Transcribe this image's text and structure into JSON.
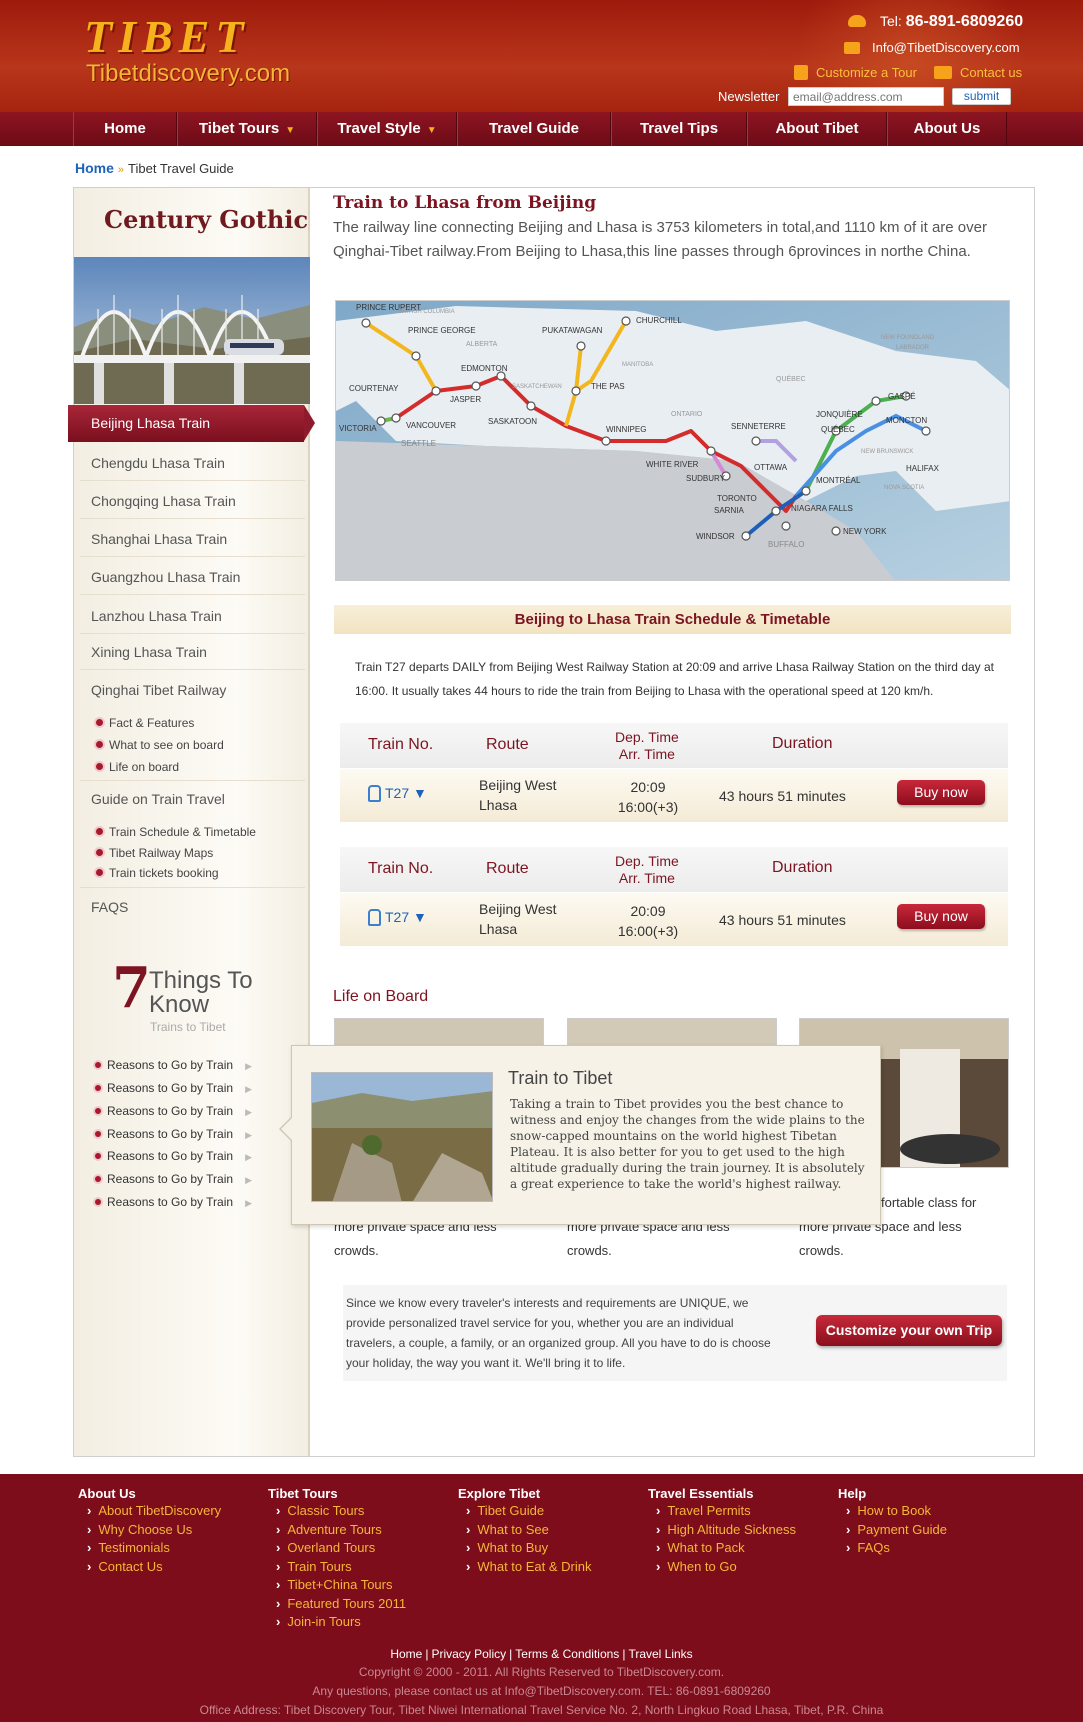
{
  "header": {
    "logo_text": "TIBET",
    "logo_sub": "Tibetdiscovery.com",
    "tel_label": "Tel:",
    "tel_number": "86-891-6809260",
    "email": "Info@TibetDiscovery.com",
    "customize_label": "Customize a Tour",
    "contact_label": "Contact us",
    "newsletter_label": "Newsletter",
    "newsletter_placeholder": "email@address.com",
    "submit_label": "submit"
  },
  "nav": {
    "items": [
      {
        "label": "Home",
        "dropdown": false
      },
      {
        "label": "Tibet Tours",
        "dropdown": true
      },
      {
        "label": "Travel Style",
        "dropdown": true
      },
      {
        "label": "Travel Guide",
        "dropdown": false
      },
      {
        "label": "Travel Tips",
        "dropdown": false
      },
      {
        "label": "About Tibet",
        "dropdown": false
      },
      {
        "label": "About Us",
        "dropdown": false
      }
    ]
  },
  "breadcrumb": {
    "home": "Home",
    "separator": "»",
    "current": "Tibet Travel Guide"
  },
  "sidebar": {
    "title": "Century Gothic",
    "active_item": "Beijing Lhasa Train",
    "items": [
      "Chengdu Lhasa Train",
      "Chongqing Lhasa Train",
      "Shanghai Lhasa Train",
      "Guangzhou Lhasa Train",
      "Lanzhou Lhasa Train",
      "Xining Lhasa Train",
      "Qinghai Tibet Railway"
    ],
    "railway_sub": [
      "Fact & Features",
      "What to see on board",
      "Life on board"
    ],
    "guide_label": "Guide on Train Travel",
    "guide_sub": [
      "Train Schedule & Timetable",
      "Tibet Railway Maps",
      "Train tickets booking"
    ],
    "faqs_label": "FAQS",
    "things": {
      "number": "7",
      "line1": "Things To",
      "line2": "Know",
      "sub": "Trains to Tibet"
    },
    "reasons": [
      "Reasons to Go by Train",
      "Reasons to Go by Train",
      "Reasons to Go by Train",
      "Reasons to Go by Train",
      "Reasons to Go by Train",
      "Reasons to Go by Train",
      "Reasons to Go by Train"
    ]
  },
  "content": {
    "title": "Train to Lhasa from Beijing",
    "intro": "The railway line connecting Beijing and Lhasa is 3753 kilometers in total,and 1110 km of it are over Qinghai-Tibet railway.From Beijing to Lhasa,this line passes through 6provinces in northe China.",
    "map_labels": {
      "prince_rupert": "PRINCE RUPERT",
      "british_columbia": "BRITISH COLUMBIA",
      "prince_george": "PRINCE GEORGE",
      "alberta": "ALBERTA",
      "pukatawagan": "PUKATAWAGAN",
      "churchill": "CHURCHILL",
      "manitoba": "MANITOBA",
      "edmonton": "EDMONTON",
      "saskatchewan": "SASKATCHEWAN",
      "the_pas": "THE PAS",
      "courtenay": "COURTENAY",
      "jasper": "JASPER",
      "victoria": "VICTORIA",
      "vancouver": "VANCOUVER",
      "saskatoon": "SASKATOON",
      "seattle": "SEATTLE",
      "ontario": "ONTARIO",
      "winnipeg": "WINNIPEG",
      "white_river": "WHITE RIVER",
      "sudbury": "SUDBURY",
      "senneterre": "SENNETERRE",
      "jonquiere": "JONQUIÈRE",
      "quebec_city": "QUÉBEC",
      "quebec_prov": "QUÉBEC",
      "gaspe": "GASPÉ",
      "moncton": "MONCTON",
      "halifax": "HALIFAX",
      "new_foundland": "NEW FOUNDLAND",
      "labrador": "LABRADOR",
      "new_brunswick": "NEW BRUNSWICK",
      "nova_scotia": "NOVA SCOTIA",
      "ottawa": "OTTAWA",
      "montreal": "MONTRÉAL",
      "toronto": "TORONTO",
      "sarnia": "SARNIA",
      "niagara_falls": "NIAGARA FALLS",
      "windsor": "WINDSOR",
      "buffalo": "BUFFALO",
      "new_york": "NEW YORK"
    },
    "schedule_heading": "Beijing to Lhasa Train Schedule & Timetable",
    "schedule_desc": "Train T27 departs DAILY from Beijing West Railway Station at 20:09 and arrive Lhasa Railway Station on the third day at 16:00. It usually takes 44 hours to ride the train from Beijing to Lhasa with the operational speed at 120 km/h.",
    "table_headers": {
      "train_no": "Train No.",
      "route": "Route",
      "dep": "Dep. Time",
      "arr": "Arr. Time",
      "duration": "Duration"
    },
    "trains": [
      {
        "no": "T27",
        "from": "Beijing West",
        "to": "Lhasa",
        "dep": "20:09",
        "arr": "16:00(+3)",
        "duration": "43 hours 51 minutes",
        "buy": "Buy now"
      },
      {
        "no": "T27",
        "from": "Beijing West",
        "to": "Lhasa",
        "dep": "20:09",
        "arr": "16:00(+3)",
        "duration": "43 hours 51 minutes",
        "buy": "Buy now"
      }
    ],
    "life_title": "Life on Board",
    "life_texts": [
      {
        "line1": "more private space and less",
        "line2": "crowds."
      },
      {
        "line1": "more private space and less",
        "line2": "crowds."
      },
      {
        "line0": "fortable class for",
        "line1": "more private space and less",
        "line2": "crowds."
      }
    ],
    "popup": {
      "title": "Train to Tibet",
      "text": "Taking a train to Tibet provides you the best chance to witness and enjoy the changes from the wide plains to the snow-capped mountains on the world highest Tibetan Plateau. It is also better for you to get used to the high altitude gradually during the train journey. It is absolutely a great experience to take the world's highest railway."
    },
    "customize": {
      "text": "Since we know every traveler's interests and requirements are UNIQUE, we provide personalized travel service for you, whether you are an individual travelers, a couple, a family, or an organized group. All you have to do is choose your holiday, the way you want it. We'll bring it to life.",
      "button": "Customize your own Trip"
    }
  },
  "footer": {
    "columns": [
      {
        "head": "About Us",
        "links": [
          "About TibetDiscovery",
          "Why Choose Us",
          "Testimonials",
          "Contact Us"
        ]
      },
      {
        "head": "Tibet Tours",
        "links": [
          "Classic Tours",
          "Adventure Tours",
          "Overland Tours",
          "Train Tours",
          "Tibet+China Tours",
          "Featured Tours 2011",
          "Join-in Tours"
        ]
      },
      {
        "head": "Explore Tibet",
        "links": [
          "Tibet Guide",
          "What to See",
          "What to Buy",
          "What to Eat & Drink"
        ]
      },
      {
        "head": "Travel Essentials",
        "links": [
          "Travel Permits",
          "High Altitude Sickness",
          "What to Pack",
          "When to Go"
        ]
      },
      {
        "head": "Help",
        "links": [
          "How to Book",
          "Payment Guide",
          "FAQs"
        ]
      }
    ],
    "bottom_links": [
      "Home",
      "Privacy Policy",
      "Terms & Conditions",
      "Travel Links"
    ],
    "copyright": "Copyright © 2000 - 2011. All Rights Reserved to TibetDiscovery.com.",
    "contact_line": "Any questions, please contact us at Info@TibetDiscovery.com. TEL: 86-0891-6809260",
    "address": "Office Address: Tibet Discovery Tour, Tibet Niwei International Travel Service No. 2, North Lingkuo Road Lhasa, Tibet, P.R. China"
  },
  "colors": {
    "brand_red": "#7c1521",
    "header_red": "#a6230f",
    "nav_red": "#7d0d1b",
    "accent_gold": "#f6b21d",
    "link_blue": "#1d63b8"
  }
}
